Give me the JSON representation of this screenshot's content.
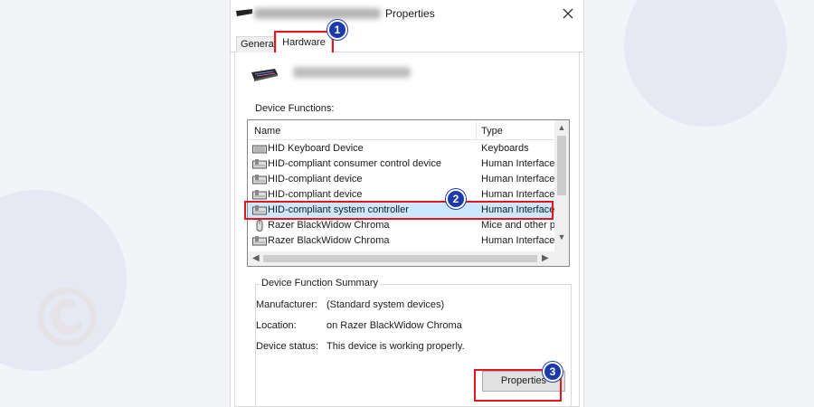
{
  "window": {
    "title_suffix": "Properties",
    "close_label": "×"
  },
  "tabs": [
    {
      "label": "General"
    },
    {
      "label": "Hardware"
    }
  ],
  "device_functions_label": "Device Functions:",
  "list": {
    "columns": {
      "name": "Name",
      "type": "Type"
    },
    "rows": [
      {
        "name": "HID Keyboard Device",
        "type": "Keyboards"
      },
      {
        "name": "HID-compliant consumer control device",
        "type": "Human Interface"
      },
      {
        "name": "HID-compliant device",
        "type": "Human Interface"
      },
      {
        "name": "HID-compliant device",
        "type": "Human Interface"
      },
      {
        "name": "HID-compliant system controller",
        "type": "Human Interface"
      },
      {
        "name": "Razer BlackWidow Chroma",
        "type": "Mice and other p"
      },
      {
        "name": "Razer BlackWidow Chroma",
        "type": "Human Interface"
      }
    ]
  },
  "summary": {
    "title": "Device Function Summary",
    "manufacturer_label": "Manufacturer:",
    "manufacturer_value": "(Standard system devices)",
    "location_label": "Location:",
    "location_value": "on Razer BlackWidow Chroma",
    "status_label": "Device status:",
    "status_value": "This device is working properly.",
    "properties_button": "Properties"
  },
  "badges": [
    "1",
    "2",
    "3"
  ],
  "colors": {
    "highlight": "#e0171f",
    "badge": "#1c3aa9",
    "selected_row": "#cce8ff"
  }
}
